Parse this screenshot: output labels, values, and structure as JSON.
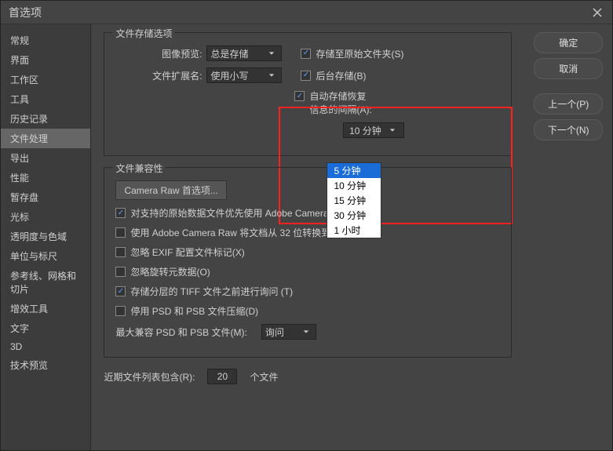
{
  "window": {
    "title": "首选项"
  },
  "sidebar": {
    "items": [
      "常规",
      "界面",
      "工作区",
      "工具",
      "历史记录",
      "文件处理",
      "导出",
      "性能",
      "暂存盘",
      "光标",
      "透明度与色域",
      "单位与标尺",
      "参考线、网格和切片",
      "增效工具",
      "文字",
      "3D",
      "技术预览"
    ],
    "activeIndex": 5
  },
  "buttons": {
    "ok": "确定",
    "cancel": "取消",
    "prev": "上一个(P)",
    "next": "下一个(N)"
  },
  "storage": {
    "legend": "文件存储选项",
    "preview_label": "图像预览:",
    "preview_value": "总是存储",
    "ext_label": "文件扩展名:",
    "ext_value": "使用小写",
    "save_original": "存储至原始文件夹(S)",
    "bg_save": "后台存储(B)",
    "autorecover": "自动存储恢复\n信息的间隔(A):",
    "interval_value": "10 分钟",
    "interval_options": [
      "5 分钟",
      "10 分钟",
      "15 分钟",
      "30 分钟",
      "1 小时"
    ]
  },
  "compat": {
    "legend": "文件兼容性",
    "camera_raw_btn": "Camera Raw 首选项...",
    "prefer_acr": "对支持的原始数据文件优先使用 Adobe Camera Raw(C)",
    "convert_bits": "使用 Adobe Camera Raw 将文档从 32 位转换到 16/8 位(U)",
    "ignore_exif": "忽略 EXIF 配置文件标记(X)",
    "ignore_rotation": "忽略旋转元数据(O)",
    "ask_tiff": "存储分层的 TIFF 文件之前进行询问 (T)",
    "disable_compress": "停用 PSD 和 PSB 文件压缩(D)",
    "max_compat_label": "最大兼容 PSD 和 PSB 文件(M):",
    "max_compat_value": "询问"
  },
  "recent": {
    "label": "近期文件列表包含(R):",
    "value": "20",
    "suffix": "个文件"
  }
}
